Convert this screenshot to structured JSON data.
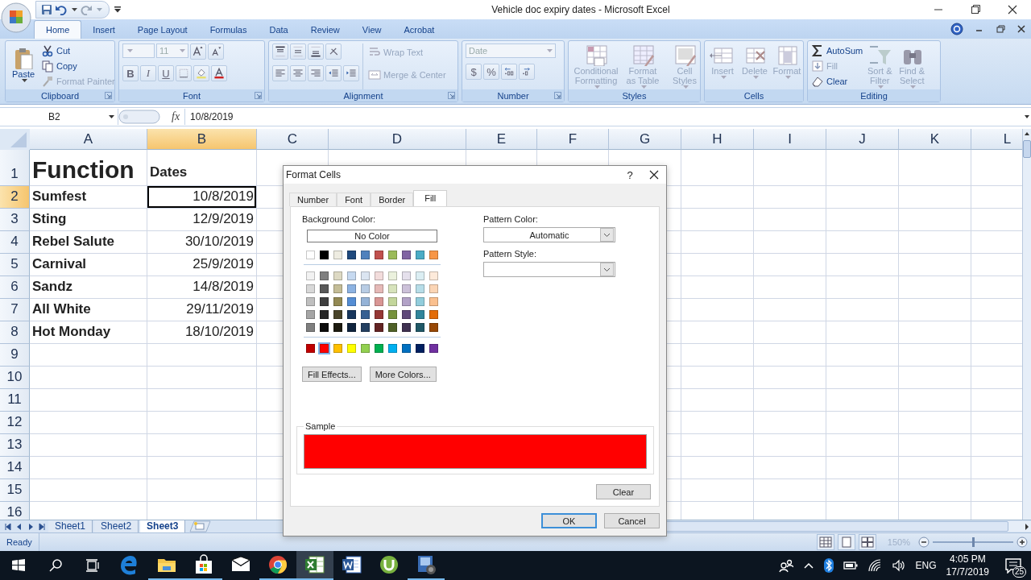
{
  "window": {
    "title": "Vehicle doc expiry dates - Microsoft Excel"
  },
  "ribbon_tabs": [
    {
      "label": "Home",
      "selected": true
    },
    {
      "label": "Insert",
      "selected": false
    },
    {
      "label": "Page Layout",
      "selected": false
    },
    {
      "label": "Formulas",
      "selected": false
    },
    {
      "label": "Data",
      "selected": false
    },
    {
      "label": "Review",
      "selected": false
    },
    {
      "label": "View",
      "selected": false
    },
    {
      "label": "Acrobat",
      "selected": false
    }
  ],
  "ribbon_groups": [
    {
      "label": "Clipboard",
      "launcher": true,
      "columns": [
        [
          {
            "kind": "large",
            "label": "Paste",
            "disabled": false
          }
        ],
        [
          {
            "kind": "small",
            "label": "Cut",
            "disabled": false
          },
          {
            "kind": "small",
            "label": "Copy",
            "disabled": false
          },
          {
            "kind": "small",
            "label": "Format Painter",
            "disabled": true
          }
        ]
      ]
    },
    {
      "label": "Font",
      "launcher": true,
      "columns": [
        [
          {
            "kind": "tools",
            "buttons": [
              {
                "kind": "combo-wide"
              },
              {
                "kind": "combo",
                "label": "11"
              },
              {
                "kind": "grow-font"
              },
              {
                "kind": "shrink-font"
              }
            ]
          },
          {
            "kind": "tools",
            "buttons": [
              {
                "kind": "bold",
                "label": "B"
              },
              {
                "kind": "italic",
                "label": "I"
              },
              {
                "kind": "underline",
                "label": "U"
              },
              {
                "kind": "borders"
              },
              {
                "kind": "fill-color"
              },
              {
                "kind": "font-color"
              }
            ]
          }
        ]
      ]
    },
    {
      "label": "Alignment",
      "launcher": true,
      "columns": [
        [
          {
            "kind": "tools",
            "buttons": [
              {
                "kind": "align-top"
              },
              {
                "kind": "align-middle"
              },
              {
                "kind": "align-bottom"
              },
              {
                "kind": "orientation"
              }
            ]
          },
          {
            "kind": "tools",
            "buttons": [
              {
                "kind": "align-left"
              },
              {
                "kind": "align-center"
              },
              {
                "kind": "align-right"
              },
              {
                "kind": "outdent"
              },
              {
                "kind": "indent"
              }
            ]
          }
        ],
        [
          {
            "kind": "small",
            "label": "Wrap Text",
            "disabled": true
          },
          {
            "kind": "small",
            "label": "Merge & Center",
            "disabled": true
          }
        ]
      ]
    },
    {
      "label": "Number",
      "launcher": true,
      "columns": [
        [
          {
            "kind": "tools",
            "buttons": [
              {
                "kind": "combo-format",
                "label": "Date"
              }
            ]
          },
          {
            "kind": "tools",
            "buttons": [
              {
                "kind": "currency",
                "label": "$"
              },
              {
                "kind": "percent",
                "label": "%"
              },
              {
                "kind": "increase-decimal"
              },
              {
                "kind": "decrease-decimal"
              }
            ]
          }
        ]
      ]
    },
    {
      "label": "Styles",
      "launcher": false,
      "columns": [
        [
          {
            "kind": "large",
            "label": "Conditional Formatting",
            "disabled": true
          }
        ],
        [
          {
            "kind": "large",
            "label": "Format as Table",
            "disabled": true
          }
        ],
        [
          {
            "kind": "large",
            "label": "Cell Styles",
            "disabled": true
          }
        ]
      ]
    },
    {
      "label": "Cells",
      "launcher": false,
      "columns": [
        [
          {
            "kind": "large",
            "label": "Insert",
            "disabled": true
          }
        ],
        [
          {
            "kind": "large",
            "label": "Delete",
            "disabled": true
          }
        ],
        [
          {
            "kind": "large",
            "label": "Format",
            "disabled": true
          }
        ]
      ]
    },
    {
      "label": "Editing",
      "launcher": false,
      "columns": [
        [
          {
            "kind": "small",
            "label": "AutoSum",
            "disabled": false
          },
          {
            "kind": "small",
            "label": "Fill",
            "disabled": true
          },
          {
            "kind": "small",
            "label": "Clear",
            "disabled": false
          }
        ],
        [
          {
            "kind": "large",
            "label": "Sort & Filter",
            "disabled": true
          }
        ],
        [
          {
            "kind": "large",
            "label": "Find & Select",
            "disabled": true
          }
        ]
      ]
    }
  ],
  "sheet": {
    "name_box": "B2",
    "fx_label": "fx",
    "formula": "10/8/2019",
    "columns": [
      {
        "label": "A",
        "selected": false
      },
      {
        "label": "B",
        "selected": true
      },
      {
        "label": "C",
        "selected": false
      },
      {
        "label": "D",
        "selected": false
      },
      {
        "label": "E",
        "selected": false
      },
      {
        "label": "F",
        "selected": false
      },
      {
        "label": "G",
        "selected": false
      },
      {
        "label": "H",
        "selected": false
      },
      {
        "label": "I",
        "selected": false
      },
      {
        "label": "J",
        "selected": false
      },
      {
        "label": "K",
        "selected": false
      },
      {
        "label": "L",
        "selected": false
      }
    ],
    "rows": [
      {
        "label": "1",
        "selected": false,
        "cells": [
          {
            "kind": "title",
            "text": "Function",
            "selected": false
          },
          {
            "kind": "heading",
            "text": "Dates",
            "selected": false
          }
        ]
      },
      {
        "label": "2",
        "selected": true,
        "cells": [
          {
            "kind": "name",
            "text": "Sumfest",
            "selected": false
          },
          {
            "kind": "date",
            "text": "10/8/2019",
            "selected": true
          }
        ]
      },
      {
        "label": "3",
        "selected": false,
        "cells": [
          {
            "kind": "name",
            "text": "Sting",
            "selected": false
          },
          {
            "kind": "date",
            "text": "12/9/2019",
            "selected": false
          }
        ]
      },
      {
        "label": "4",
        "selected": false,
        "cells": [
          {
            "kind": "name",
            "text": "Rebel Salute",
            "selected": false
          },
          {
            "kind": "date",
            "text": "30/10/2019",
            "selected": false
          }
        ]
      },
      {
        "label": "5",
        "selected": false,
        "cells": [
          {
            "kind": "name",
            "text": "Carnival",
            "selected": false
          },
          {
            "kind": "date",
            "text": "25/9/2019",
            "selected": false
          }
        ]
      },
      {
        "label": "6",
        "selected": false,
        "cells": [
          {
            "kind": "name",
            "text": "Sandz",
            "selected": false
          },
          {
            "kind": "date",
            "text": "14/8/2019",
            "selected": false
          }
        ]
      },
      {
        "label": "7",
        "selected": false,
        "cells": [
          {
            "kind": "name",
            "text": "All White",
            "selected": false
          },
          {
            "kind": "date",
            "text": "29/11/2019",
            "selected": false
          }
        ]
      },
      {
        "label": "8",
        "selected": false,
        "cells": [
          {
            "kind": "name",
            "text": "Hot Monday",
            "selected": false
          },
          {
            "kind": "date",
            "text": "18/10/2019",
            "selected": false
          }
        ]
      },
      {
        "label": "9",
        "selected": false
      },
      {
        "label": "10",
        "selected": false
      },
      {
        "label": "11",
        "selected": false
      },
      {
        "label": "12",
        "selected": false
      },
      {
        "label": "13",
        "selected": false
      },
      {
        "label": "14",
        "selected": false
      },
      {
        "label": "15",
        "selected": false
      },
      {
        "label": "16",
        "selected": false
      }
    ]
  },
  "sheet_tabs": [
    {
      "label": "Sheet1",
      "selected": false
    },
    {
      "label": "Sheet2",
      "selected": false
    },
    {
      "label": "Sheet3",
      "selected": true
    }
  ],
  "status_bar": {
    "status": "Ready",
    "zoom": {
      "label": "150%",
      "level": 0.5
    }
  },
  "dialog": {
    "title": "Format Cells",
    "help": "?",
    "tabs": [
      {
        "label": "Number",
        "selected": false
      },
      {
        "label": "Font",
        "selected": false
      },
      {
        "label": "Border",
        "selected": false
      },
      {
        "label": "Fill",
        "selected": true
      }
    ],
    "background_label": "Background Color:",
    "no_color": "No Color",
    "palette": [
      {
        "kind": "theme",
        "swatches": [
          {
            "color": "#ffffff",
            "selected": false
          },
          {
            "color": "#000000",
            "selected": false
          },
          {
            "color": "#eeece1",
            "selected": false
          },
          {
            "color": "#1f497d",
            "selected": false
          },
          {
            "color": "#4f81bd",
            "selected": false
          },
          {
            "color": "#c0504d",
            "selected": false
          },
          {
            "color": "#9bbb59",
            "selected": false
          },
          {
            "color": "#8064a2",
            "selected": false
          },
          {
            "color": "#4bacc6",
            "selected": false
          },
          {
            "color": "#f79646",
            "selected": false
          }
        ]
      },
      {
        "kind": "tint",
        "swatches": [
          {
            "color": "#f2f2f2",
            "selected": false
          },
          {
            "color": "#7f7f7f",
            "selected": false
          },
          {
            "color": "#ddd9c3",
            "selected": false
          },
          {
            "color": "#c6d9f0",
            "selected": false
          },
          {
            "color": "#dbe5f1",
            "selected": false
          },
          {
            "color": "#f2dcdb",
            "selected": false
          },
          {
            "color": "#ebf1dd",
            "selected": false
          },
          {
            "color": "#e5e0ec",
            "selected": false
          },
          {
            "color": "#dbeef3",
            "selected": false
          },
          {
            "color": "#fdeada",
            "selected": false
          }
        ]
      },
      {
        "kind": "tint",
        "swatches": [
          {
            "color": "#d8d8d8",
            "selected": false
          },
          {
            "color": "#595959",
            "selected": false
          },
          {
            "color": "#c4bd97",
            "selected": false
          },
          {
            "color": "#8db3e2",
            "selected": false
          },
          {
            "color": "#b8cce4",
            "selected": false
          },
          {
            "color": "#e5b9b7",
            "selected": false
          },
          {
            "color": "#d7e3bc",
            "selected": false
          },
          {
            "color": "#ccc1d9",
            "selected": false
          },
          {
            "color": "#b7dde8",
            "selected": false
          },
          {
            "color": "#fbd5b5",
            "selected": false
          }
        ]
      },
      {
        "kind": "tint",
        "swatches": [
          {
            "color": "#bfbfbf",
            "selected": false
          },
          {
            "color": "#3f3f3f",
            "selected": false
          },
          {
            "color": "#938953",
            "selected": false
          },
          {
            "color": "#548dd4",
            "selected": false
          },
          {
            "color": "#95b3d7",
            "selected": false
          },
          {
            "color": "#d99694",
            "selected": false
          },
          {
            "color": "#c3d69b",
            "selected": false
          },
          {
            "color": "#b2a2c7",
            "selected": false
          },
          {
            "color": "#92cddc",
            "selected": false
          },
          {
            "color": "#fac08f",
            "selected": false
          }
        ]
      },
      {
        "kind": "tint",
        "swatches": [
          {
            "color": "#a5a5a5",
            "selected": false
          },
          {
            "color": "#262626",
            "selected": false
          },
          {
            "color": "#494429",
            "selected": false
          },
          {
            "color": "#17365d",
            "selected": false
          },
          {
            "color": "#366092",
            "selected": false
          },
          {
            "color": "#953734",
            "selected": false
          },
          {
            "color": "#76923c",
            "selected": false
          },
          {
            "color": "#5f497a",
            "selected": false
          },
          {
            "color": "#31859b",
            "selected": false
          },
          {
            "color": "#e36c09",
            "selected": false
          }
        ]
      },
      {
        "kind": "tint",
        "swatches": [
          {
            "color": "#7f7f7f",
            "selected": false
          },
          {
            "color": "#0c0c0c",
            "selected": false
          },
          {
            "color": "#1d1b10",
            "selected": false
          },
          {
            "color": "#0f243e",
            "selected": false
          },
          {
            "color": "#244061",
            "selected": false
          },
          {
            "color": "#632423",
            "selected": false
          },
          {
            "color": "#4f6128",
            "selected": false
          },
          {
            "color": "#3f3151",
            "selected": false
          },
          {
            "color": "#205867",
            "selected": false
          },
          {
            "color": "#974806",
            "selected": false
          }
        ]
      },
      {
        "kind": "standard",
        "swatches": [
          {
            "color": "#c00000",
            "selected": false
          },
          {
            "color": "#ff0000",
            "selected": true
          },
          {
            "color": "#ffc000",
            "selected": false
          },
          {
            "color": "#ffff00",
            "selected": false
          },
          {
            "color": "#92d050",
            "selected": false
          },
          {
            "color": "#00b050",
            "selected": false
          },
          {
            "color": "#00b0f0",
            "selected": false
          },
          {
            "color": "#0070c0",
            "selected": false
          },
          {
            "color": "#002060",
            "selected": false
          },
          {
            "color": "#7030a0",
            "selected": false
          }
        ]
      }
    ],
    "fill_buttons": [
      "Fill Effects...",
      "More Colors..."
    ],
    "pattern_color": {
      "label": "Pattern Color:",
      "value": "Automatic"
    },
    "pattern_style": {
      "label": "Pattern Style:"
    },
    "sample": {
      "label": "Sample",
      "color": "#ff0000"
    },
    "clear": "Clear",
    "buttons": [
      {
        "label": "OK",
        "default": true
      },
      {
        "label": "Cancel",
        "default": false
      }
    ]
  },
  "taskbar": {
    "apps": [
      {
        "kind": "edge",
        "running": false,
        "active": false
      },
      {
        "kind": "explorer",
        "running": true,
        "active": false
      },
      {
        "kind": "store",
        "running": true,
        "active": false
      },
      {
        "kind": "mail",
        "running": false,
        "active": false
      },
      {
        "kind": "chrome",
        "running": true,
        "active": false
      },
      {
        "kind": "excel",
        "running": true,
        "active": true
      },
      {
        "kind": "word",
        "running": false,
        "active": false
      },
      {
        "kind": "utorrent",
        "running": false,
        "active": false
      },
      {
        "kind": "video",
        "running": true,
        "active": false
      }
    ],
    "language": "ENG",
    "time": "4:05 PM",
    "date": "17/7/2019",
    "notifications": "25"
  }
}
